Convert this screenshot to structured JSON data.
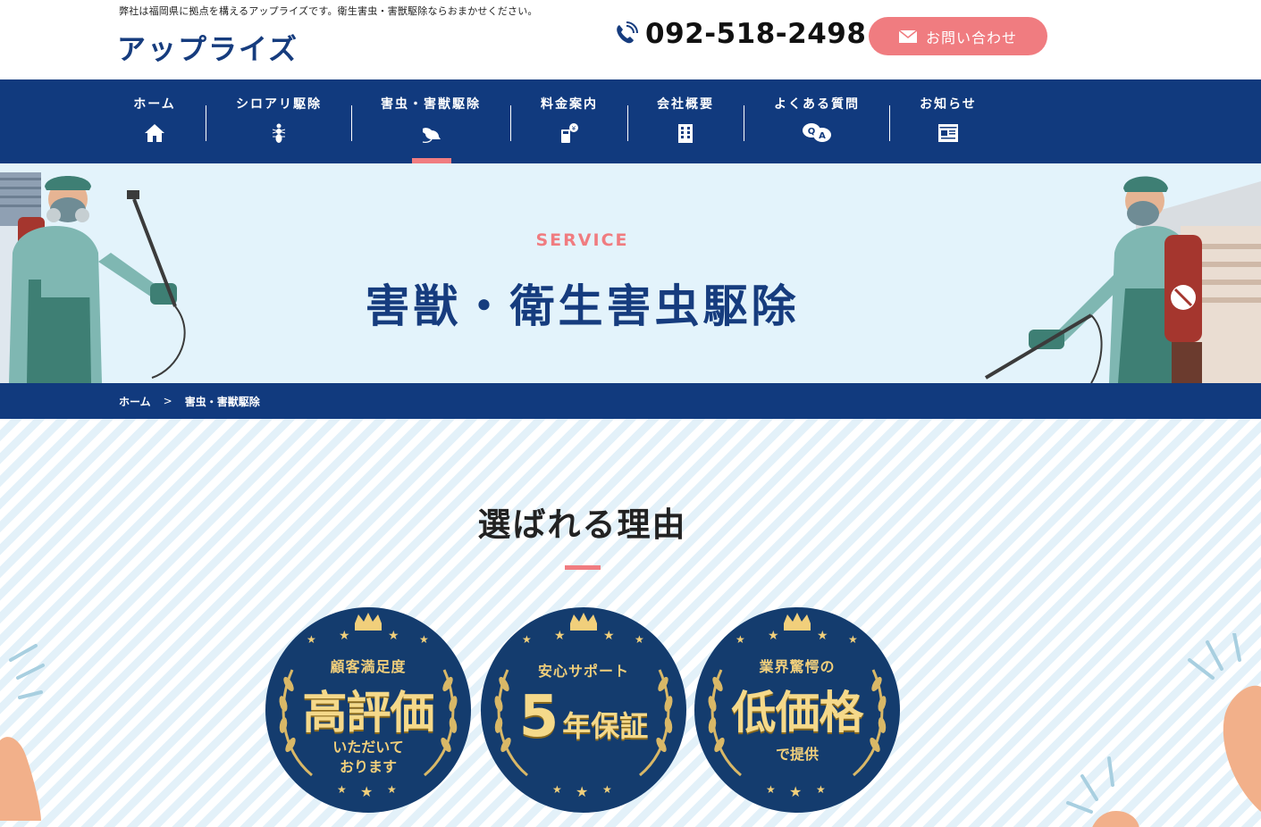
{
  "header": {
    "tagline": "弊社は福岡県に拠点を構えるアップライズです。衛生害虫・害獣駆除ならおまかせください。",
    "logo": "アップライズ",
    "phone": "092-518-2498",
    "contact_label": "お問い合わせ"
  },
  "nav": {
    "items": [
      {
        "label": "ホーム",
        "icon": "home-icon"
      },
      {
        "label": "シロアリ駆除",
        "icon": "termite-icon"
      },
      {
        "label": "害虫・害獣駆除",
        "icon": "rat-icon"
      },
      {
        "label": "料金案内",
        "icon": "price-icon"
      },
      {
        "label": "会社概要",
        "icon": "building-icon"
      },
      {
        "label": "よくある質問",
        "icon": "qa-icon"
      },
      {
        "label": "お知らせ",
        "icon": "news-icon"
      }
    ],
    "active_index": 2
  },
  "hero": {
    "eyebrow": "SERVICE",
    "title": "害獣・衛生害虫駆除"
  },
  "breadcrumb": {
    "home": "ホーム",
    "separator": ">",
    "current": "害虫・害獣駆除"
  },
  "reasons": {
    "title": "選ばれる理由",
    "badges": [
      {
        "top": "顧客満足度",
        "main": "高評価",
        "bottom1": "いただいて",
        "bottom2": "おります"
      },
      {
        "top": "安心サポート",
        "main_num": "5",
        "main": "年保証"
      },
      {
        "top": "業界驚愕の",
        "main": "低価格",
        "bottom1": "で提供"
      }
    ]
  },
  "colors": {
    "navy": "#113a7e",
    "accent_pink": "#f07c80",
    "hero_bg": "#e3f3fb",
    "badge_gold": "#f1cf7b"
  }
}
